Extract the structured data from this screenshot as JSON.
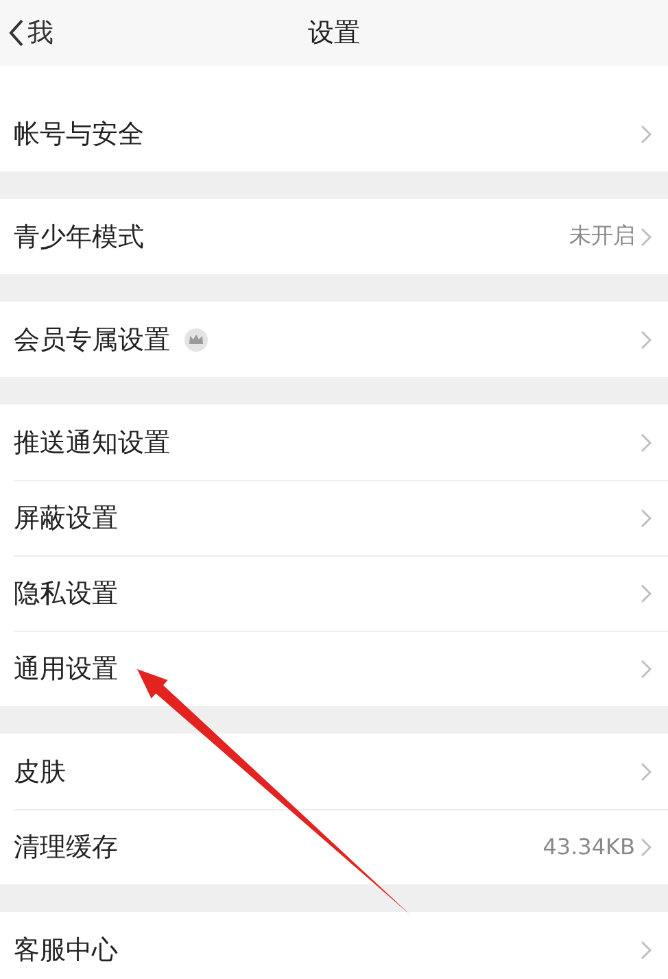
{
  "header": {
    "back_label": "我",
    "title": "设置"
  },
  "groups": [
    {
      "items": [
        {
          "label": "帐号与安全",
          "kind": "plain"
        }
      ]
    },
    {
      "items": [
        {
          "label": "青少年模式",
          "kind": "plain",
          "value": "未开启"
        }
      ]
    },
    {
      "items": [
        {
          "label": "会员专属设置",
          "kind": "badge"
        }
      ]
    },
    {
      "items": [
        {
          "label": "推送通知设置",
          "kind": "plain"
        },
        {
          "label": "屏蔽设置",
          "kind": "plain"
        },
        {
          "label": "隐私设置",
          "kind": "plain"
        },
        {
          "label": "通用设置",
          "kind": "plain"
        }
      ]
    },
    {
      "items": [
        {
          "label": "皮肤",
          "kind": "plain"
        },
        {
          "label": "清理缓存",
          "kind": "plain",
          "value": "43.34KB"
        }
      ]
    },
    {
      "items": [
        {
          "label": "客服中心",
          "kind": "plain"
        }
      ]
    }
  ]
}
